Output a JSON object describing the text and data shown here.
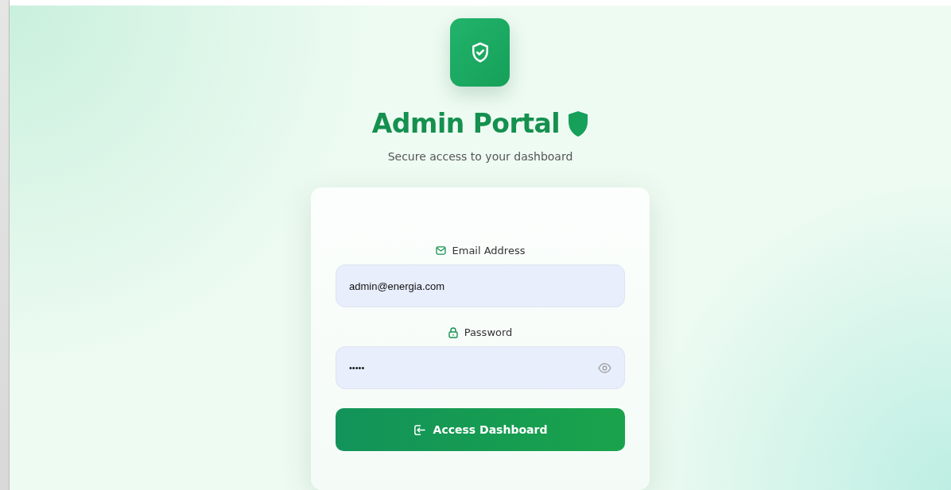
{
  "header": {
    "title": "Admin Portal",
    "subtitle": "Secure access to your dashboard"
  },
  "fields": [
    {
      "kind": "email",
      "label": "Email Address",
      "value": "admin@energia.com"
    },
    {
      "kind": "password",
      "label": "Password",
      "value": "•••••"
    }
  ],
  "submit_button": {
    "label": "Access Dashboard"
  }
}
